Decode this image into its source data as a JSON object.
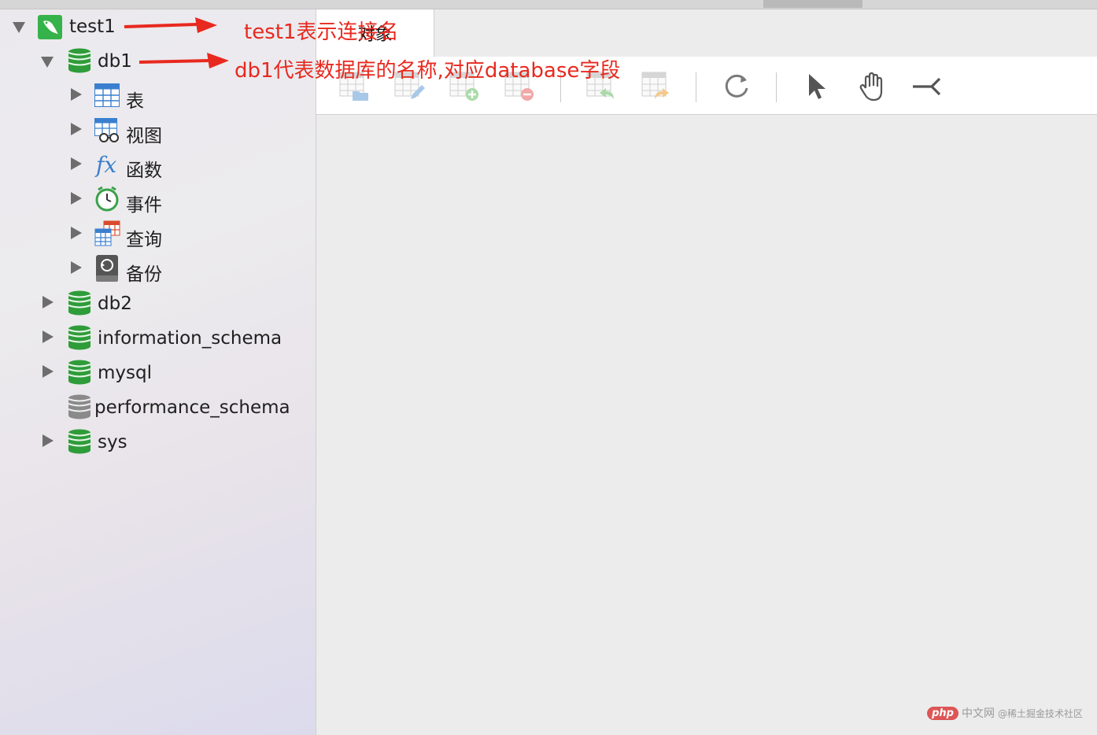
{
  "tree": {
    "connection": {
      "label": "test1"
    },
    "db1": {
      "label": "db1"
    },
    "children": [
      {
        "label": "表",
        "icon": "table-icon"
      },
      {
        "label": "视图",
        "icon": "view-icon"
      },
      {
        "label": "函数",
        "icon": "function-icon"
      },
      {
        "label": "事件",
        "icon": "event-icon"
      },
      {
        "label": "查询",
        "icon": "query-icon"
      },
      {
        "label": "备份",
        "icon": "backup-icon"
      }
    ],
    "databases": [
      {
        "label": "db2"
      },
      {
        "label": "information_schema"
      },
      {
        "label": "mysql"
      },
      {
        "label": "performance_schema"
      },
      {
        "label": "sys"
      }
    ]
  },
  "main": {
    "tab_label": "对象"
  },
  "annotations": {
    "a1": "test1表示连接名",
    "a2": "db1代表数据库的名称,对应database字段"
  },
  "watermark": {
    "logo": "php",
    "text": "中文网",
    "sub": "@稀土掘金技术社区"
  },
  "colors": {
    "annotation": "#e8291f",
    "db_green": "#2f9c3a",
    "db_gray": "#8a8a8a"
  }
}
